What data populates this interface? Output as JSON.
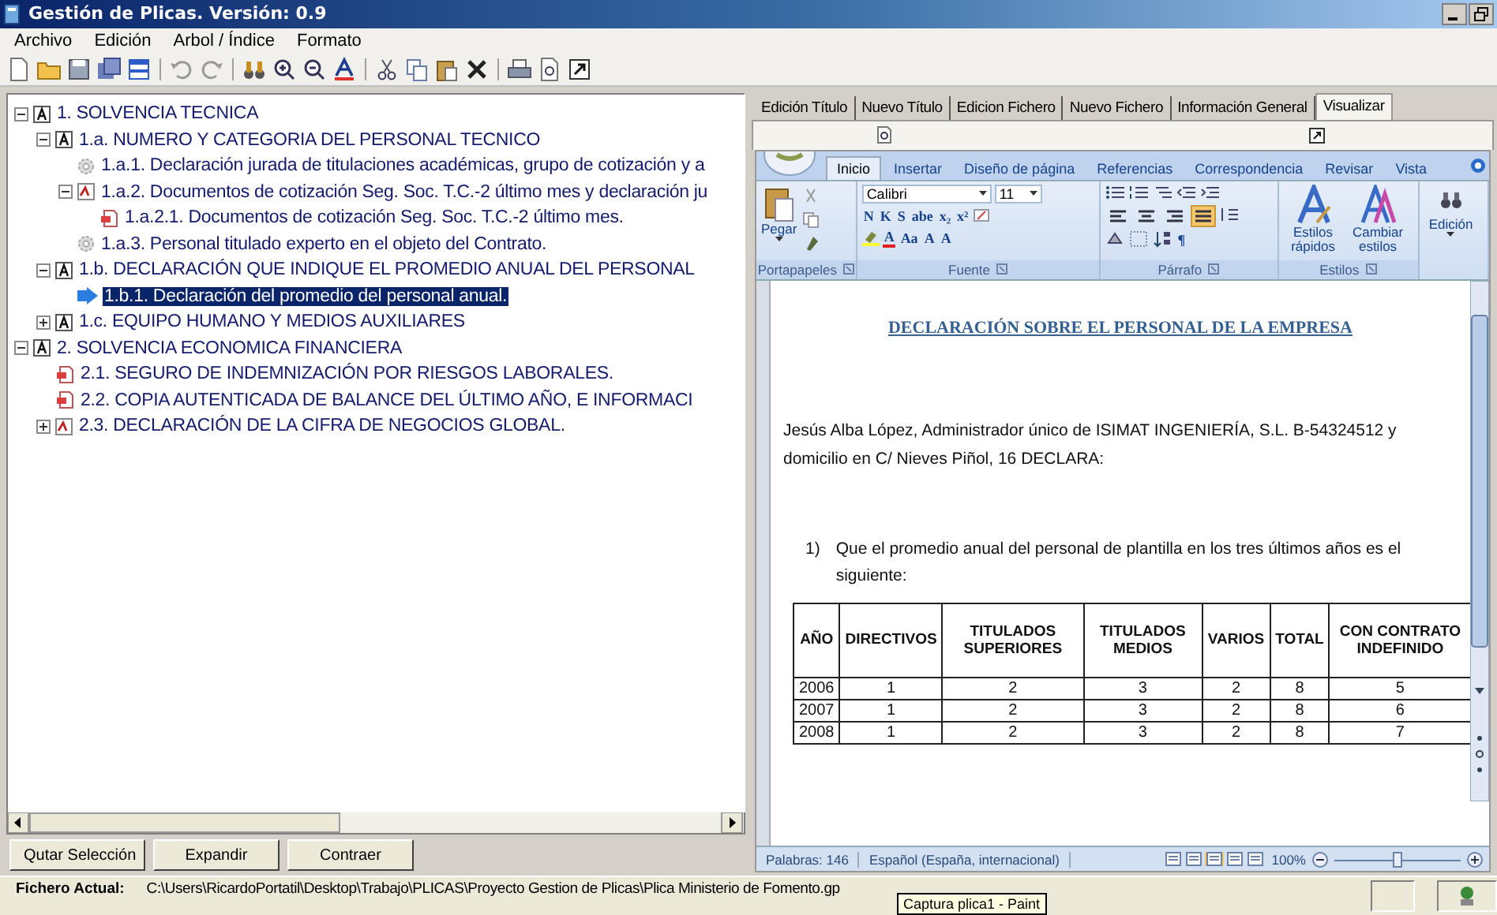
{
  "window": {
    "title": "Gestión de Plicas. Versión: 0.9"
  },
  "menu": [
    "Archivo",
    "Edición",
    "Arbol / Índice",
    "Formato"
  ],
  "tree": {
    "items": [
      {
        "kind": "section",
        "label": "1. SOLVENCIA TECNICA",
        "expanded": true,
        "selected": false,
        "children": [
          {
            "kind": "section",
            "label": "1.a. NUMERO Y CATEGORIA DEL PERSONAL TECNICO",
            "expanded": true,
            "selected": false,
            "children": [
              {
                "kind": "gear",
                "label": "1.a.1. Declaración jurada de titulaciones académicas, grupo de cotización y a",
                "selected": false
              },
              {
                "kind": "form",
                "label": "1.a.2. Documentos de cotización Seg. Soc. T.C.-2 último mes y declaración ju",
                "expanded": true,
                "selected": false,
                "children": [
                  {
                    "kind": "pdf",
                    "label": "1.a.2.1. Documentos de cotización Seg. Soc. T.C.-2 último mes.",
                    "selected": false
                  }
                ]
              },
              {
                "kind": "gear",
                "label": "1.a.3. Personal titulado experto en el objeto del Contrato.",
                "selected": false
              }
            ]
          },
          {
            "kind": "section",
            "label": "1.b. DECLARACIÓN QUE INDIQUE EL PROMEDIO ANUAL DEL PERSONAL",
            "expanded": true,
            "selected": false,
            "children": [
              {
                "kind": "arrow",
                "label": "1.b.1. Declaración del promedio del personal anual.",
                "selected": true
              }
            ]
          },
          {
            "kind": "section",
            "label": "1.c. EQUIPO HUMANO Y MEDIOS AUXILIARES",
            "expanded": false,
            "selected": false
          }
        ]
      },
      {
        "kind": "section",
        "label": "2. SOLVENCIA ECONOMICA FINANCIERA",
        "expanded": true,
        "selected": false,
        "children": [
          {
            "kind": "pdf",
            "label": "2.1. SEGURO DE INDEMNIZACIÓN POR RIESGOS LABORALES.",
            "selected": false
          },
          {
            "kind": "pdf",
            "label": "2.2. COPIA AUTENTICADA DE BALANCE DEL ÚLTIMO AÑO, E INFORMACI",
            "selected": false
          },
          {
            "kind": "form",
            "label": "2.3. DECLARACIÓN DE LA CIFRA DE NEGOCIOS GLOBAL.",
            "expanded": false,
            "selected": false
          }
        ]
      }
    ]
  },
  "tree_buttons": [
    "Qutar Selección",
    "Expandir",
    "Contraer"
  ],
  "panel_tabs": [
    {
      "label": "Edición Título",
      "selected": false
    },
    {
      "label": "Nuevo Título",
      "selected": false
    },
    {
      "label": "Edicion Fichero",
      "selected": false
    },
    {
      "label": "Nuevo Fichero",
      "selected": false
    },
    {
      "label": "Información General",
      "selected": false
    },
    {
      "label": "Visualizar",
      "selected": true
    }
  ],
  "word": {
    "ribbon_tabs": [
      {
        "label": "Inicio",
        "selected": true
      },
      {
        "label": "Insertar",
        "selected": false
      },
      {
        "label": "Diseño de página",
        "selected": false
      },
      {
        "label": "Referencias",
        "selected": false
      },
      {
        "label": "Correspondencia",
        "selected": false
      },
      {
        "label": "Revisar",
        "selected": false
      },
      {
        "label": "Vista",
        "selected": false
      }
    ],
    "clipboard": {
      "paste": "Pegar",
      "label": "Portapapeles"
    },
    "font": {
      "name": "Calibri",
      "size": "11",
      "format_buttons": [
        "N",
        "K",
        "S",
        "abe",
        "x₂",
        "x²"
      ],
      "color_button": "A",
      "case_button": "Aa",
      "grow_shrink": [
        "A",
        "A"
      ],
      "label": "Fuente"
    },
    "paragraph": {
      "alignments": [
        {
          "selected": false
        },
        {
          "selected": false
        },
        {
          "selected": false
        },
        {
          "selected": true
        }
      ],
      "pilcrow": "¶",
      "label": "Párrafo"
    },
    "styles": {
      "quick": "Estilos rápidos",
      "change": "Cambiar estilos",
      "label": "Estilos"
    },
    "editing": {
      "label": "Edición"
    },
    "document": {
      "heading": "DECLARACIÓN SOBRE EL PERSONAL DE LA EMPRESA",
      "paragraph": "Jesús Alba López, Administrador único de ISIMAT INGENIERÍA, S.L.  B-54324512 y domicilio en C/ Nieves Piñol, 16 DECLARA:",
      "list_item": {
        "number": "1)",
        "text": "Que el promedio anual del personal de plantilla en los tres últimos años es el siguiente:"
      },
      "table": {
        "columns": [
          "AÑO",
          "DIRECTIVOS",
          "TITULADOS SUPERIORES",
          "TITULADOS MEDIOS",
          "VARIOS",
          "TOTAL",
          "CON CONTRATO INDEFINIDO"
        ],
        "rows": [
          [
            "2006",
            "1",
            "2",
            "3",
            "2",
            "8",
            "5"
          ],
          [
            "2007",
            "1",
            "2",
            "3",
            "2",
            "8",
            "6"
          ],
          [
            "2008",
            "1",
            "2",
            "3",
            "2",
            "8",
            "7"
          ]
        ]
      }
    },
    "status": {
      "words": "Palabras: 146",
      "language": "Español (España, internacional)",
      "views": [
        {
          "selected": false
        },
        {
          "selected": false
        },
        {
          "selected": true
        },
        {
          "selected": false
        },
        {
          "selected": false
        }
      ],
      "zoom": "100%",
      "zoom_slider": {
        "level": 0.5
      }
    }
  },
  "status_bar": {
    "label": "Fichero Actual:",
    "path": "C:\\Users\\RicardoPortatil\\Desktop\\Trabajo\\PLICAS\\Proyecto Gestion de Plicas\\Plica Ministerio de Fomento.gp"
  },
  "tooltip": "Captura plica1 - Paint"
}
